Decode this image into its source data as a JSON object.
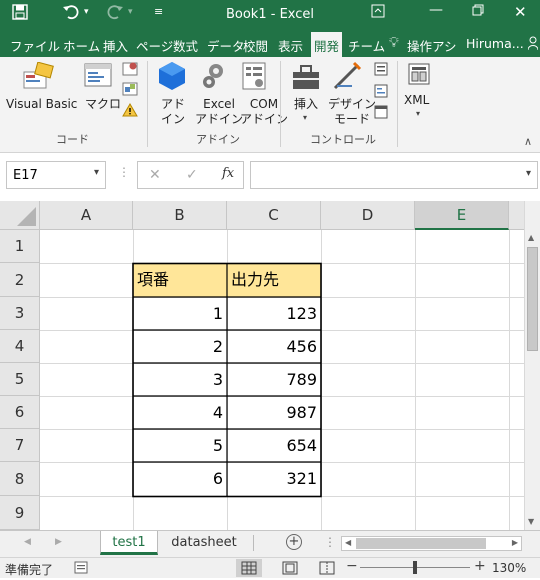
{
  "titlebar": {
    "title": "Book1  -  Excel",
    "save_icon": "save-icon",
    "undo_icon": "undo-icon",
    "redo_icon": "redo-icon",
    "customize_icon": "customize-qat-icon"
  },
  "tabs": [
    {
      "label": "ファイル"
    },
    {
      "label": "ホーム"
    },
    {
      "label": "挿入"
    },
    {
      "label": "ページ"
    },
    {
      "label": "数式"
    },
    {
      "label": "データ"
    },
    {
      "label": "校閲"
    },
    {
      "label": "表示"
    },
    {
      "label": "開発"
    },
    {
      "label": "チーム"
    }
  ],
  "tell_me": "操作アシ",
  "user": "Hiruma...",
  "ribbon": {
    "visual_basic": "Visual Basic",
    "macro": "マクロ",
    "group_code": "コード",
    "addin_line1": "アド",
    "addin_line2": "イン",
    "excel_addin_line1": "Excel",
    "excel_addin_line2": "アドイン",
    "com_addin_line1": "COM",
    "com_addin_line2": "アドイン",
    "group_addin": "アドイン",
    "insert": "挿入",
    "design_line1": "デザイン",
    "design_line2": "モード",
    "group_controls": "コントロール",
    "xml": "XML"
  },
  "formula_bar": {
    "name_box": "E17",
    "cancel": "✕",
    "enter": "✓",
    "fx": "fx",
    "formula": ""
  },
  "sheet": {
    "columns": [
      "A",
      "B",
      "C",
      "D",
      "E"
    ],
    "selected_column": "E",
    "rows": [
      "1",
      "2",
      "3",
      "4",
      "5",
      "6",
      "7",
      "8",
      "9"
    ],
    "header_b": "項番",
    "header_c": "出力先",
    "data": [
      [
        "1",
        "123"
      ],
      [
        "2",
        "456"
      ],
      [
        "3",
        "789"
      ],
      [
        "4",
        "987"
      ],
      [
        "5",
        "654"
      ],
      [
        "6",
        "321"
      ]
    ],
    "header_fill": "#ffe699"
  },
  "sheet_tabs": {
    "tabs": [
      {
        "label": "test1"
      },
      {
        "label": "datasheet"
      }
    ],
    "active": "test1"
  },
  "status": {
    "ready": "準備完了",
    "zoom": "130%"
  },
  "colors": {
    "accent": "#217346"
  }
}
